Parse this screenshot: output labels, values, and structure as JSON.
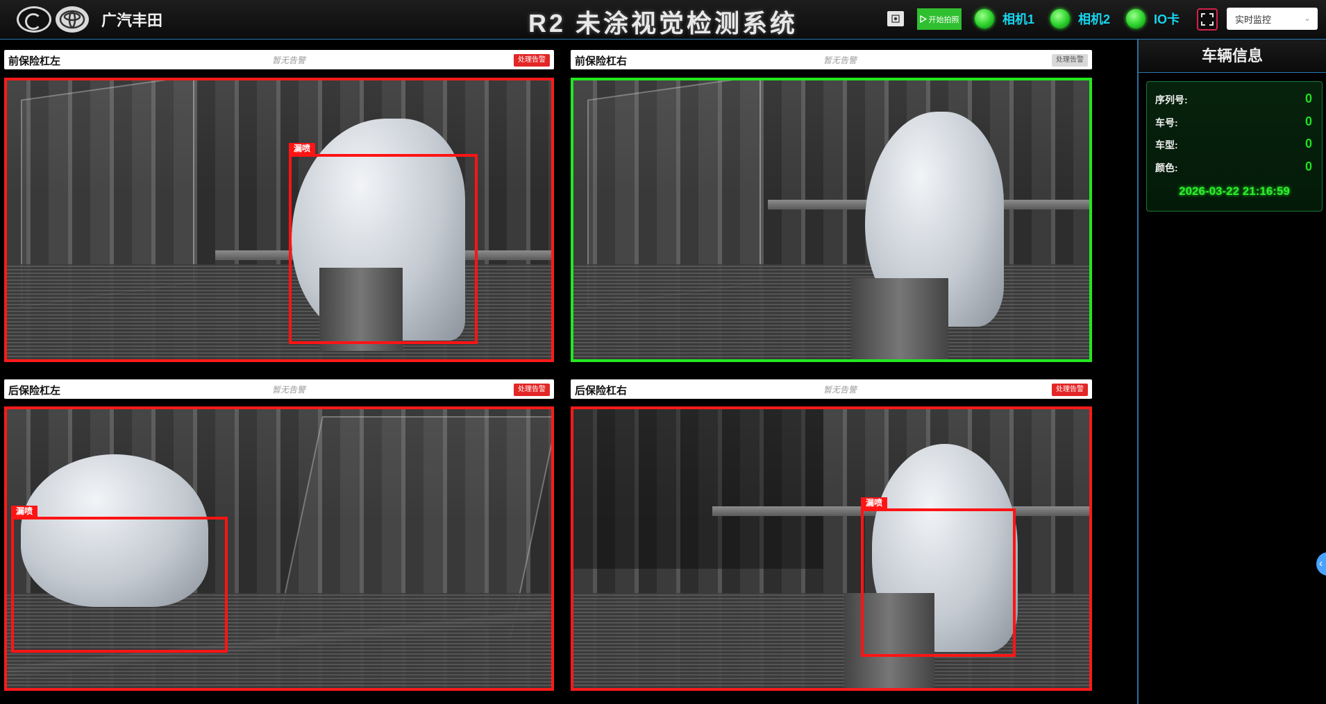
{
  "header": {
    "brand_name": "广汽丰田",
    "app_title": "R2 未涂视觉检测系统",
    "start_button_label": "开始拍照",
    "statuses": [
      {
        "label": "相机1",
        "color": "#2ad12a"
      },
      {
        "label": "相机2",
        "color": "#2ad12a"
      },
      {
        "label": "IO卡",
        "color": "#2ad12a"
      }
    ],
    "mode_selected": "实时监控"
  },
  "panels": [
    {
      "name": "前保险杠左",
      "alarm_text": "暂无告警",
      "process_label": "处理告警",
      "status": "alarm",
      "detections": [
        {
          "label": "漏喷"
        }
      ]
    },
    {
      "name": "前保险杠右",
      "alarm_text": "暂无告警",
      "process_label": "处理告警",
      "status": "ok",
      "detections": []
    },
    {
      "name": "后保险杠左",
      "alarm_text": "暂无告警",
      "process_label": "处理告警",
      "status": "alarm",
      "detections": [
        {
          "label": "漏喷"
        }
      ]
    },
    {
      "name": "后保险杠右",
      "alarm_text": "暂无告警",
      "process_label": "处理告警",
      "status": "alarm",
      "detections": [
        {
          "label": "漏喷"
        }
      ]
    }
  ],
  "vehicle_info": {
    "title": "车辆信息",
    "rows": [
      {
        "label": "序列号:",
        "value": "0"
      },
      {
        "label": "车号:",
        "value": "0"
      },
      {
        "label": "车型:",
        "value": "0"
      },
      {
        "label": "颜色:",
        "value": "0"
      }
    ],
    "datetime": "2026-03-22 21:16:59"
  },
  "colors": {
    "alarm": "#ff1a1a",
    "ok": "#22e81f",
    "accent": "#17d6f0"
  }
}
